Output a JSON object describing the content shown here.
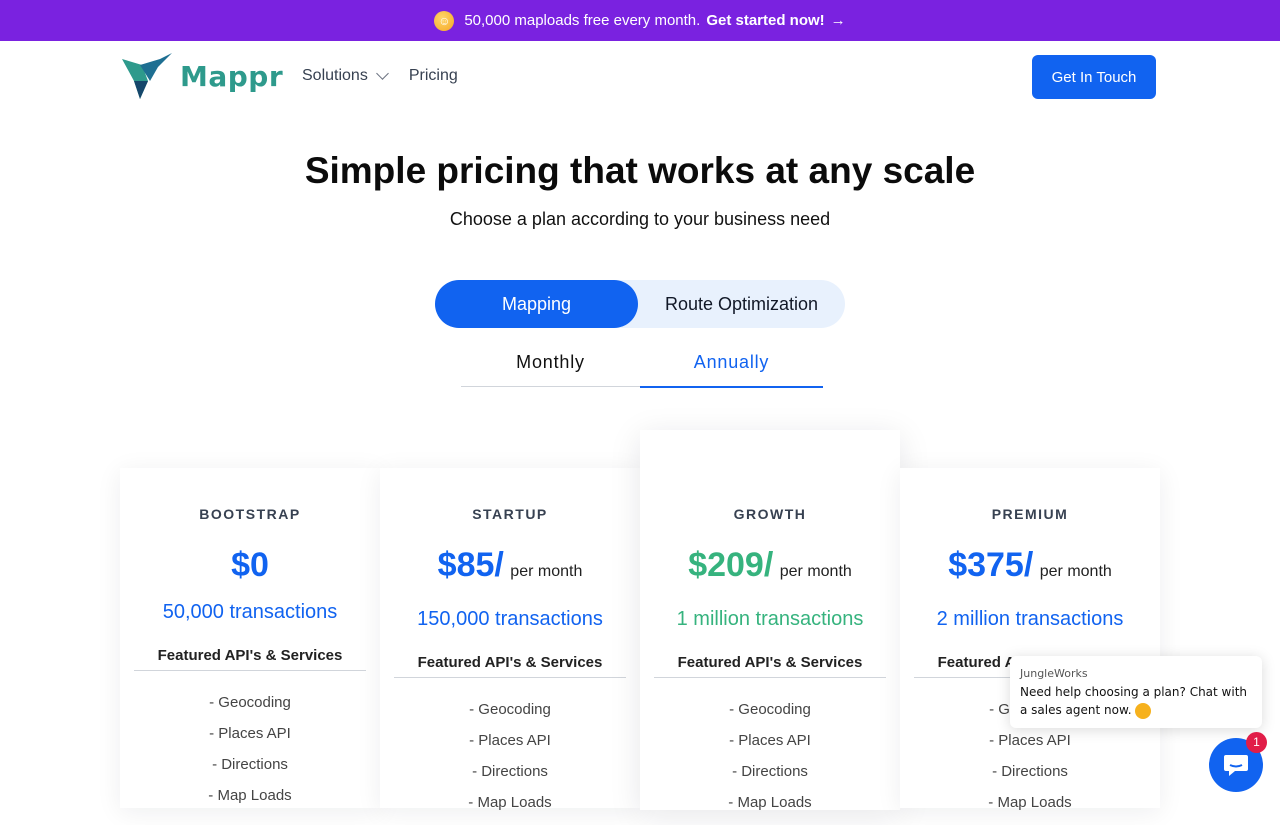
{
  "promo": {
    "text": "50,000 maploads free every month.",
    "cta": "Get started now!",
    "arrow": "→"
  },
  "nav": {
    "brand": "Mappr",
    "items": [
      {
        "label": "Solutions"
      },
      {
        "label": "Pricing"
      }
    ],
    "cta": "Get In Touch"
  },
  "hero": {
    "title": "Simple pricing that works at any scale",
    "subtitle": "Choose a plan according to your business need"
  },
  "product_toggle": {
    "active": "Mapping",
    "inactive": "Route Optimization"
  },
  "billing_tabs": {
    "monthly": "Monthly",
    "annually": "Annually",
    "selected": "Annually"
  },
  "plans": [
    {
      "name": "BOOTSTRAP",
      "price": "$0",
      "per": "",
      "transactions": "50,000 transactions",
      "features_title": "Featured API's & Services",
      "features": [
        "- Geocoding",
        "- Places API",
        "- Directions",
        "- Map Loads"
      ]
    },
    {
      "name": "STARTUP",
      "price": "$85/",
      "per": "per month",
      "transactions": "150,000 transactions",
      "features_title": "Featured API's & Services",
      "features": [
        "- Geocoding",
        "- Places API",
        "- Directions",
        "- Map Loads"
      ]
    },
    {
      "name": "GROWTH",
      "price": "$209/",
      "per": "per month",
      "transactions": "1 million transactions",
      "features_title": "Featured API's & Services",
      "features": [
        "- Geocoding",
        "- Places API",
        "- Directions",
        "- Map Loads"
      ],
      "accent": "#36b37e"
    },
    {
      "name": "PREMIUM",
      "price": "$375/",
      "per": "per month",
      "transactions": "2 million transactions",
      "features_title": "Featured API's & Services",
      "features": [
        "- Geocoding",
        "- Places API",
        "- Directions",
        "- Map Loads"
      ]
    }
  ],
  "chat": {
    "agent": "JungleWorks",
    "message": "Need help choosing a plan? Chat with a sales agent now.",
    "badge": "1"
  },
  "colors": {
    "primary": "#1163f0",
    "promo": "#7a22e0",
    "growth": "#36b37e",
    "brand": "#2e9a8c"
  }
}
